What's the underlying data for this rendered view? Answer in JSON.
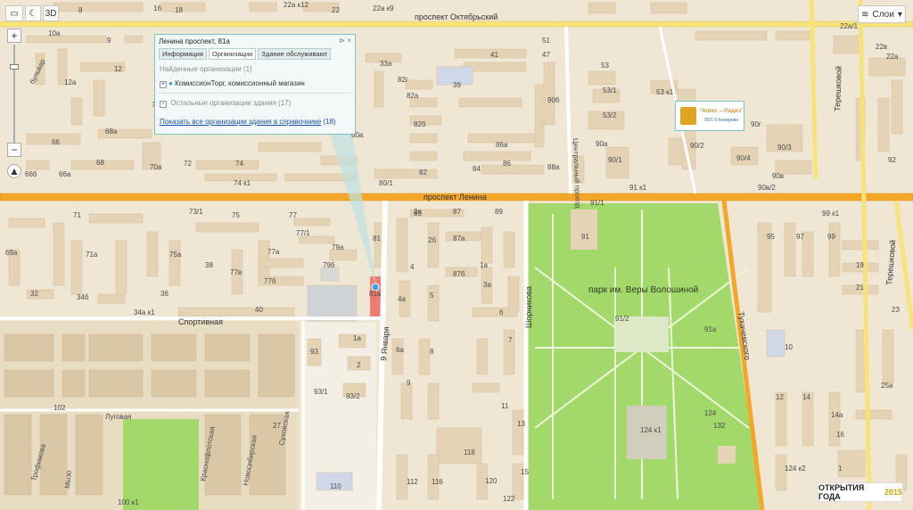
{
  "toolbar": {
    "view_3d_label": "3D"
  },
  "layers_button": {
    "label": "Слои",
    "icon": "layers-icon"
  },
  "popup": {
    "title": "Ленина проспект, 81а",
    "tabs": [
      "Информация",
      "Организации",
      "Здание обслуживают"
    ],
    "active_tab": 1,
    "found_header": "Найденные организации (1)",
    "found_item": "КомиссионТорг, комиссионный магазин",
    "other_header": "Остальные организации здания (17)",
    "all_link": "Показать все организации здания в справочнике",
    "all_count": "(18)"
  },
  "streets": {
    "oktyabrsky": "проспект Октябрьский",
    "lenina": "проспект Ленина",
    "sportivnaya": "Спортивная",
    "yanvarya": "9 Января",
    "shornikova": "Шорникова",
    "tukhachevskogo": "Тухачевского",
    "tereshkovoy_1": "Терешковой",
    "tereshkovoy_2": "Терешковой",
    "tsentralny": "Центральный проезд",
    "lugovaya": "Луговая",
    "krasnoflotskaya": "Краснофлотская",
    "novosibirskaya": "Новосибирская",
    "sukhovskaya": "Суховская",
    "trofimova": "Трофимова",
    "muzo": "Мызо",
    "bulvar": "бульвар"
  },
  "park_label": "парк им. Веры Волошиной",
  "apex": {
    "title": "\"Апекс – Радио\"",
    "sub": "90/1 б Кемерово"
  },
  "badge": {
    "text": "ОТКРЫТИЯ ГОДА",
    "year": "2015"
  },
  "house_numbers": [
    {
      "t": "8"
    },
    {
      "t": "16"
    },
    {
      "t": "18"
    },
    {
      "t": "22а к12"
    },
    {
      "t": "22"
    },
    {
      "t": "22а к9"
    },
    {
      "t": "10а"
    },
    {
      "t": "9"
    },
    {
      "t": "12а"
    },
    {
      "t": "12"
    },
    {
      "t": "33а"
    },
    {
      "t": "39"
    },
    {
      "t": "41"
    },
    {
      "t": "47"
    },
    {
      "t": "51"
    },
    {
      "t": "53"
    },
    {
      "t": "53/1"
    },
    {
      "t": "53 к1"
    },
    {
      "t": "53/2"
    },
    {
      "t": "90/2"
    },
    {
      "t": "90/1"
    },
    {
      "t": "90/3"
    },
    {
      "t": "90г"
    },
    {
      "t": "90/4"
    },
    {
      "t": "90в"
    },
    {
      "t": "90б"
    },
    {
      "t": "90а"
    },
    {
      "t": "88а"
    },
    {
      "t": "86"
    },
    {
      "t": "86а"
    },
    {
      "t": "84"
    },
    {
      "t": "82"
    },
    {
      "t": "82а"
    },
    {
      "t": "82б"
    },
    {
      "t": "82г"
    },
    {
      "t": "80а"
    },
    {
      "t": "80/1"
    },
    {
      "t": "74 к1"
    },
    {
      "t": "74"
    },
    {
      "t": "72"
    },
    {
      "t": "70а"
    },
    {
      "t": "70"
    },
    {
      "t": "68"
    },
    {
      "t": "68а"
    },
    {
      "t": "66"
    },
    {
      "t": "66б"
    },
    {
      "t": "66а"
    },
    {
      "t": "73/1"
    },
    {
      "t": "75"
    },
    {
      "t": "77"
    },
    {
      "t": "77/1"
    },
    {
      "t": "79а"
    },
    {
      "t": "79б"
    },
    {
      "t": "77а"
    },
    {
      "t": "77б"
    },
    {
      "t": "77в"
    },
    {
      "t": "81"
    },
    {
      "t": "81а"
    },
    {
      "t": "85"
    },
    {
      "t": "87"
    },
    {
      "t": "89"
    },
    {
      "t": "87а"
    },
    {
      "t": "87б"
    },
    {
      "t": "91"
    },
    {
      "t": "91/1"
    },
    {
      "t": "91/2"
    },
    {
      "t": "91а"
    },
    {
      "t": "91 к1"
    },
    {
      "t": "90в/2"
    },
    {
      "t": "99 к1"
    },
    {
      "t": "92"
    },
    {
      "t": "22а/1"
    },
    {
      "t": "22в"
    },
    {
      "t": "22а"
    },
    {
      "t": "71"
    },
    {
      "t": "71а"
    },
    {
      "t": "75а"
    },
    {
      "t": "69а"
    },
    {
      "t": "32"
    },
    {
      "t": "34б"
    },
    {
      "t": "34а к1"
    },
    {
      "t": "36"
    },
    {
      "t": "38"
    },
    {
      "t": "40"
    },
    {
      "t": "95"
    },
    {
      "t": "97"
    },
    {
      "t": "99"
    },
    {
      "t": "19"
    },
    {
      "t": "21"
    },
    {
      "t": "23"
    },
    {
      "t": "25а"
    },
    {
      "t": "10"
    },
    {
      "t": "12"
    },
    {
      "t": "14"
    },
    {
      "t": "14а"
    },
    {
      "t": "16"
    },
    {
      "t": "124 к2"
    },
    {
      "t": "124"
    },
    {
      "t": "124 к1"
    },
    {
      "t": "132"
    },
    {
      "t": "1"
    },
    {
      "t": "1а"
    },
    {
      "t": "2"
    },
    {
      "t": "2а"
    },
    {
      "t": "2б"
    },
    {
      "t": "4"
    },
    {
      "t": "4а"
    },
    {
      "t": "5"
    },
    {
      "t": "6"
    },
    {
      "t": "6а"
    },
    {
      "t": "8"
    },
    {
      "t": "9"
    },
    {
      "t": "11"
    },
    {
      "t": "13"
    },
    {
      "t": "15"
    },
    {
      "t": "93"
    },
    {
      "t": "93/1"
    },
    {
      "t": "93/2"
    },
    {
      "t": "102"
    },
    {
      "t": "100 к1"
    },
    {
      "t": "27"
    },
    {
      "t": "110"
    },
    {
      "t": "112"
    },
    {
      "t": "116"
    },
    {
      "t": "118"
    },
    {
      "t": "120"
    },
    {
      "t": "122"
    },
    {
      "t": "1а"
    },
    {
      "t": "3а"
    },
    {
      "t": "7"
    }
  ],
  "colors": {
    "background": "#efe6d4",
    "building": "#e5d3b5",
    "main_road": "#f4a629",
    "yellow_road": "#f7e37a",
    "park": "#a3d96a",
    "popup_border": "#7cc4c4"
  }
}
